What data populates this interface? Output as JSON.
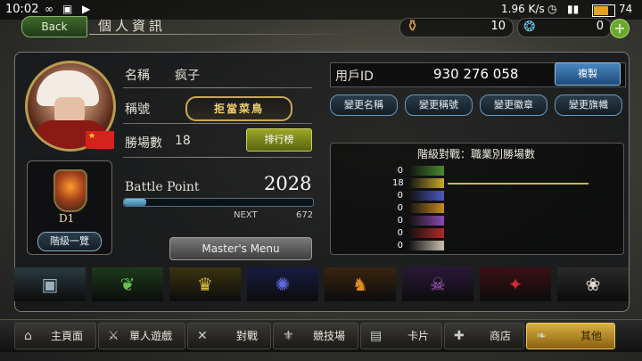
{
  "status": {
    "time": "10:02",
    "speed": "1.96 K/s",
    "battery": "74"
  },
  "header": {
    "back_label": "Back",
    "page_title": "個人資訊"
  },
  "resources": {
    "gold": "10",
    "crystal": "0"
  },
  "profile": {
    "name_label": "名稱",
    "name_value": "疯子",
    "title_label": "稱號",
    "title_badge": "拒當菜鳥",
    "wins_label": "勝場數",
    "wins_value": "18",
    "rank_button": "排行榜",
    "bp_label": "Battle Point",
    "bp_value": "2028",
    "next_label": "NEXT",
    "next_value": "672",
    "bp_progress": 0.12,
    "menu_button": "Master's Menu"
  },
  "grade": {
    "code": "D1",
    "button": "階級一覽"
  },
  "user": {
    "id_label": "用戶ID",
    "id_value": "930 276 058",
    "copy_button": "複製"
  },
  "change_buttons": [
    "變更名稱",
    "變更稱號",
    "變更徽章",
    "變更旗幟"
  ],
  "ladder": {
    "title": "階級對戰：職業別勝場數",
    "rows": [
      {
        "count": "0",
        "color": "#4a8a30",
        "value": 0
      },
      {
        "count": "18",
        "color": "#c8a830",
        "value": 18
      },
      {
        "count": "0",
        "color": "#4a5ac0",
        "value": 0
      },
      {
        "count": "0",
        "color": "#c88a20",
        "value": 0
      },
      {
        "count": "0",
        "color": "#8a4ab0",
        "value": 0
      },
      {
        "count": "0",
        "color": "#b02a2a",
        "value": 0
      },
      {
        "count": "0",
        "color": "#c8c0b0",
        "value": 0
      }
    ]
  },
  "job_icons": [
    {
      "name": "card-icon",
      "glyph": "▣",
      "bg": "#2a3a40",
      "fg": "#9ab0bc"
    },
    {
      "name": "leaf-icon",
      "glyph": "❦",
      "bg": "#1c3a1c",
      "fg": "#6ac04a"
    },
    {
      "name": "crown-icon",
      "glyph": "♛",
      "bg": "#3a3410",
      "fg": "#e0c040"
    },
    {
      "name": "star-emblem-icon",
      "glyph": "✺",
      "bg": "#181c40",
      "fg": "#5a6ad8"
    },
    {
      "name": "dragon-icon",
      "glyph": "♞",
      "bg": "#3a2410",
      "fg": "#e09020"
    },
    {
      "name": "skull-icon",
      "glyph": "☠",
      "bg": "#2a1838",
      "fg": "#b060d0"
    },
    {
      "name": "bat-icon",
      "glyph": "✦",
      "bg": "#3a1014",
      "fg": "#d02a34"
    },
    {
      "name": "wings-icon",
      "glyph": "❀",
      "bg": "#2a2a2a",
      "fg": "#e0d8c8"
    }
  ],
  "nav": [
    {
      "label": "主頁面",
      "icon": "⌂"
    },
    {
      "label": "單人遊戲",
      "icon": "⚔"
    },
    {
      "label": "對戰",
      "icon": "✕"
    },
    {
      "label": "競技場",
      "icon": "⚜"
    },
    {
      "label": "卡片",
      "icon": "▤"
    },
    {
      "label": "商店",
      "icon": "✚"
    },
    {
      "label": "其他",
      "icon": "❧"
    }
  ]
}
